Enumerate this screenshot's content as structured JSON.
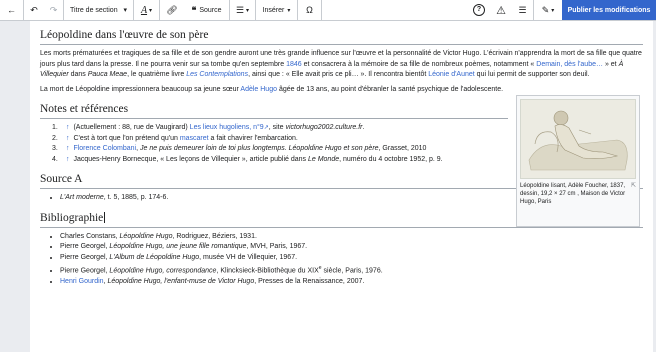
{
  "toolbar": {
    "heading_label": "Titre de section",
    "cite_label": "Source",
    "insert_label": "Insérer",
    "special_char": "Ω",
    "publish_label": "Publier les modifications"
  },
  "section1": {
    "title": "Léopoldine dans l'œuvre de son père",
    "p1_a": "Les morts prématurées et tragiques de sa fille et de son gendre auront une très grande influence sur l'œuvre et la personnalité de Victor Hugo. L'écrivain n'apprendra la mort de sa fille que quatre jours plus tard dans la presse. Il ne pourra venir sur sa tombe qu'en septembre ",
    "p1_link1": "1846",
    "p1_b": " et consacrera à la mémoire de sa fille de nombreux poèmes, notamment « ",
    "p1_link2": "Demain, dès l'aube…",
    "p1_c": " » et ",
    "p1_italic1": "À Villequier",
    "p1_d": " dans ",
    "p1_italic2": "Pauca Meae",
    "p1_e": ", le quatrième livre ",
    "p1_link3": "Les Contemplations",
    "p1_f": ", ainsi que : « Elle avait pris ce pli… ». Il rencontra bientôt ",
    "p1_link4": "Léonie d'Aunet",
    "p1_g": " qui lui permit de supporter son deuil.",
    "p2_a": "La mort de Léopoldine impressionnera beaucoup sa jeune sœur ",
    "p2_link": "Adèle Hugo",
    "p2_b": " âgée de 13 ans, au point d'ébranler la santé psychique de l'adolescente."
  },
  "thumb": {
    "caption": "Léopoldine lisant, Adèle Foucher, 1837, dessin, 19,2 × 27 cm , Maison de Victor Hugo, Paris",
    "magnify": "⇱"
  },
  "notes": {
    "title": "Notes et références",
    "items": [
      {
        "num": "1.",
        "a": "(Actuellement : 88, rue de Vaugirard) ",
        "link": "Les lieux hugoliens, n°9",
        "b": ", site ",
        "italic": "victorhugo2002.culture.fr",
        "c": "."
      },
      {
        "num": "2.",
        "a": "C'est à tort que l'on prétend qu'un ",
        "link": "mascaret",
        "b": " a fait chavirer l'embarcation."
      },
      {
        "num": "3.",
        "link": "Florence Colombani",
        "a": ", ",
        "italic": "Je ne puis demeurer loin de toi plus longtemps. Léopoldine Hugo et son père",
        "b": ", Grasset, 2010"
      },
      {
        "num": "4.",
        "a": "Jacques-Henry Bornecque, « Les leçons de Villequier », article publié dans ",
        "italic": "Le Monde",
        "b": ", numéro du 4 octobre 1952, p. 9."
      }
    ],
    "backlink": "↑"
  },
  "source": {
    "title": "Source A",
    "italic": "L'Art moderne",
    "rest": ", t. 5, 1885, p. 174-6."
  },
  "biblio": {
    "title": "Bibliographie",
    "items": [
      {
        "a": "Charles Constans, ",
        "italic": "Léopoldine Hugo",
        "b": ", Rodriguez, Béziers, 1931."
      },
      {
        "a": "Pierre Georgel, ",
        "italic": "Léopoldine Hugo, une jeune fille romantique",
        "b": ", MVH, Paris, 1967."
      },
      {
        "a": "Pierre Georgel, ",
        "italic": "L'Album de Léopoldine Hugo",
        "b": ", musée VH de Villequier, 1967."
      },
      {
        "a": "Pierre Georgel, ",
        "italic": "Léopoldine Hugo, correspondance",
        "b": ", Klincksieck-Bibliothèque du XIX",
        "sup": "e",
        "c": " siècle, Paris, 1976."
      },
      {
        "link": "Henri Gourdin",
        "a": ", ",
        "italic": "Léopoldine Hugo, l'enfant-muse de Victor Hugo",
        "b": ", Presses de la Renaissance, 2007."
      }
    ]
  }
}
